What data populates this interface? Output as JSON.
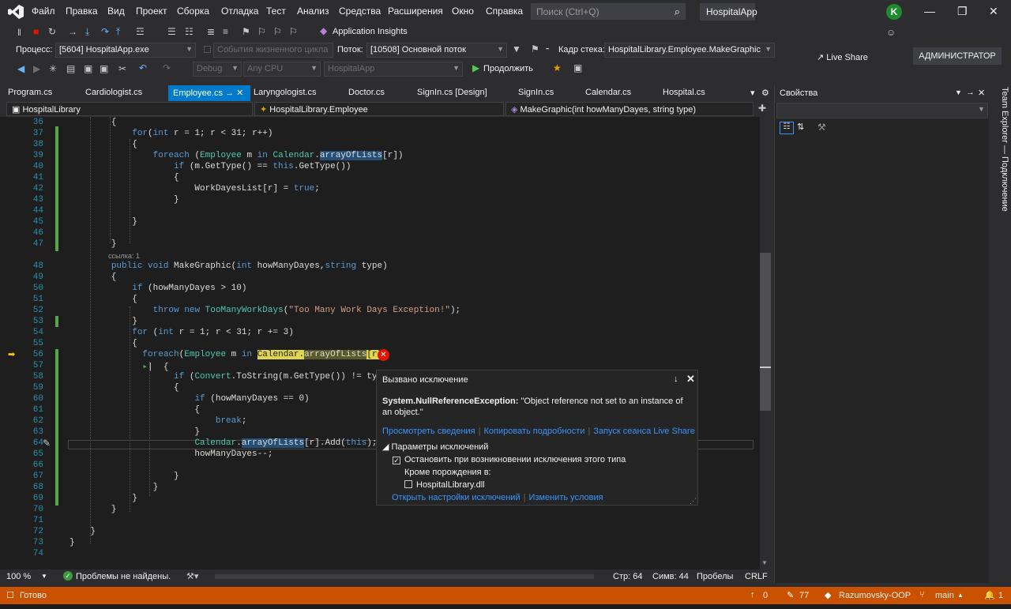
{
  "menu": [
    "Файл",
    "Правка",
    "Вид",
    "Проект",
    "Сборка",
    "Отладка",
    "Тест",
    "Анализ",
    "Средства",
    "Расширения",
    "Окно",
    "Справка"
  ],
  "search": {
    "placeholder": "Поиск (Ctrl+Q)"
  },
  "app_name": "HospitalApp",
  "user_initial": "K",
  "toolbar": {
    "app_insights": "Application Insights",
    "live_share": "Live Share",
    "admin": "АДМИНИСТРАТОР",
    "process_label": "Процесс:",
    "process_value": "[5604] HospitalApp.exe",
    "lifecycle": "События жизненного цикла",
    "thread_label": "Поток:",
    "thread_value": "[10508] Основной поток",
    "stack_label": "Кадр стека:",
    "stack_value": "HospitalLibrary.Employee.MakeGraphic",
    "config": "Debug",
    "platform": "Any CPU",
    "project": "HospitalApp",
    "continue": "Продолжить"
  },
  "tabs": [
    "Program.cs",
    "Cardiologist.cs",
    "Employee.cs",
    "Laryngologist.cs",
    "Doctor.cs",
    "SignIn.cs [Design]",
    "SignIn.cs",
    "Calendar.cs",
    "Hospital.cs"
  ],
  "nav": {
    "project": "HospitalLibrary",
    "class": "HospitalLibrary.Employee",
    "member": "MakeGraphic(int howManyDayes, string type)"
  },
  "ref_count": "ссылка: 1",
  "line_numbers": [
    "36",
    "37",
    "38",
    "39",
    "40",
    "41",
    "42",
    "43",
    "44",
    "45",
    "46",
    "47",
    "48",
    "49",
    "50",
    "51",
    "52",
    "53",
    "54",
    "55",
    "56",
    "57",
    "58",
    "59",
    "60",
    "61",
    "62",
    "63",
    "64",
    "65",
    "66",
    "67",
    "68",
    "69",
    "70",
    "71",
    "72",
    "73",
    "74"
  ],
  "popup": {
    "title": "Вызвано исключение",
    "exception_type": "System.NullReferenceException:",
    "exception_message": "\"Object reference not set to an instance of an object.\"",
    "link_details": "Просмотреть сведения",
    "link_copy": "Копировать подробности",
    "link_liveshare": "Запуск сеанса Live Share",
    "params_header": "Параметры исключений",
    "break_option": "Остановить при возникновении исключения этого типа",
    "except_label": "Кроме порождения в:",
    "dll": "HospitalLibrary.dll",
    "link_settings": "Открыть настройки исключений",
    "link_conditions": "Изменить условия"
  },
  "properties": {
    "title": "Свойства"
  },
  "team_explorer": "Team Explorer — Подключение",
  "editor_status": {
    "zoom": "100 %",
    "problems": "Проблемы не найдены.",
    "line": "Стр: 64",
    "col": "Симв: 44",
    "spaces": "Пробелы",
    "eol": "CRLF"
  },
  "status": {
    "ready": "Готово",
    "up": "0",
    "pending": "77",
    "repo": "Razumovsky-OOP",
    "branch": "main",
    "notifications": "1"
  }
}
